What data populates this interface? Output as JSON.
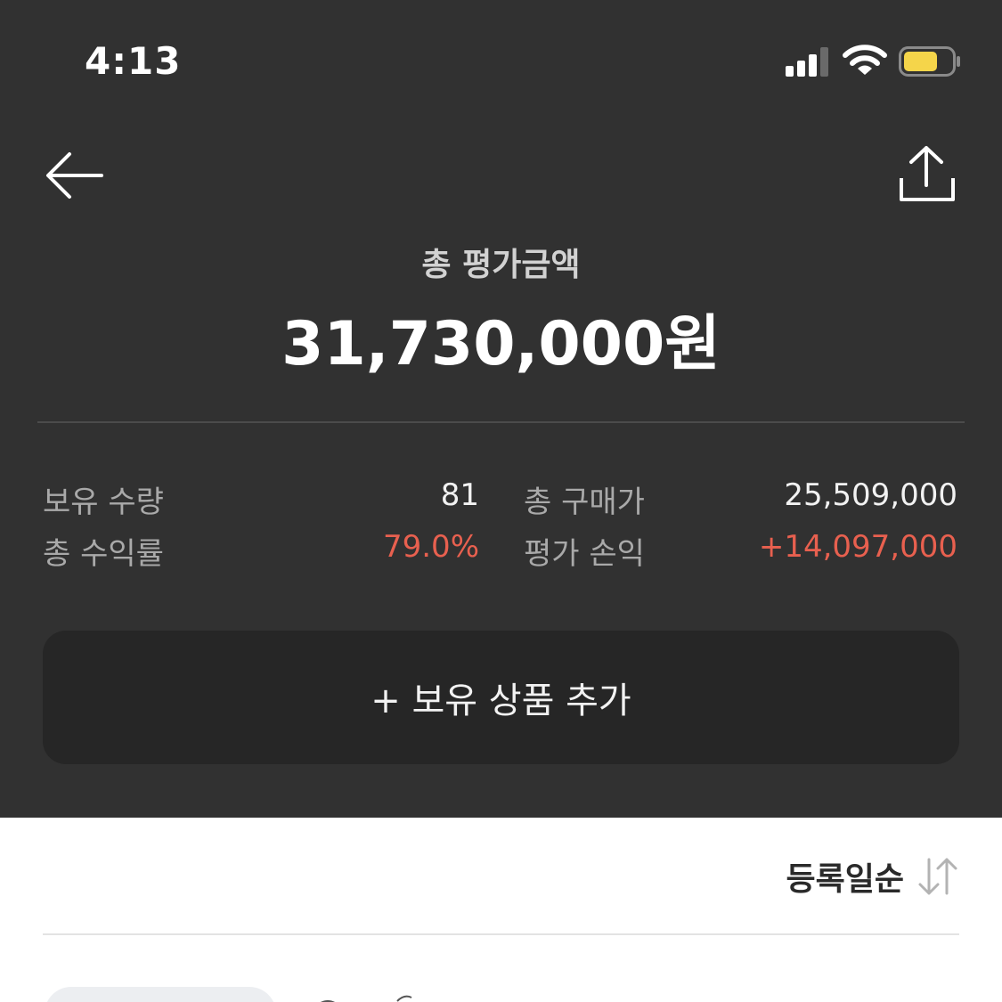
{
  "status_bar": {
    "time": "4:13",
    "icons": [
      "cellular-signal-icon",
      "wifi-icon",
      "battery-icon"
    ],
    "battery_color": "#f5d54a"
  },
  "header": {
    "back_icon": "arrow-left-icon",
    "share_icon": "share-upload-icon",
    "total_label": "총 평가금액",
    "total_value": "31,730,000원"
  },
  "summary": {
    "holding_qty_label": "보유 수량",
    "holding_qty_value": "81",
    "total_cost_label": "총 구매가",
    "total_cost_value": "25,509,000",
    "return_rate_label": "총 수익률",
    "return_rate_value": "79.0%",
    "profit_label": "평가 손익",
    "profit_value": "+14,097,000"
  },
  "actions": {
    "add_holding_label": "+ 보유 상품 추가"
  },
  "sort": {
    "label": "등록일순",
    "icon": "sort-arrows-icon"
  },
  "colors": {
    "dark_background": "#313131",
    "button_background": "#262626",
    "profit_red": "#e8604f"
  }
}
